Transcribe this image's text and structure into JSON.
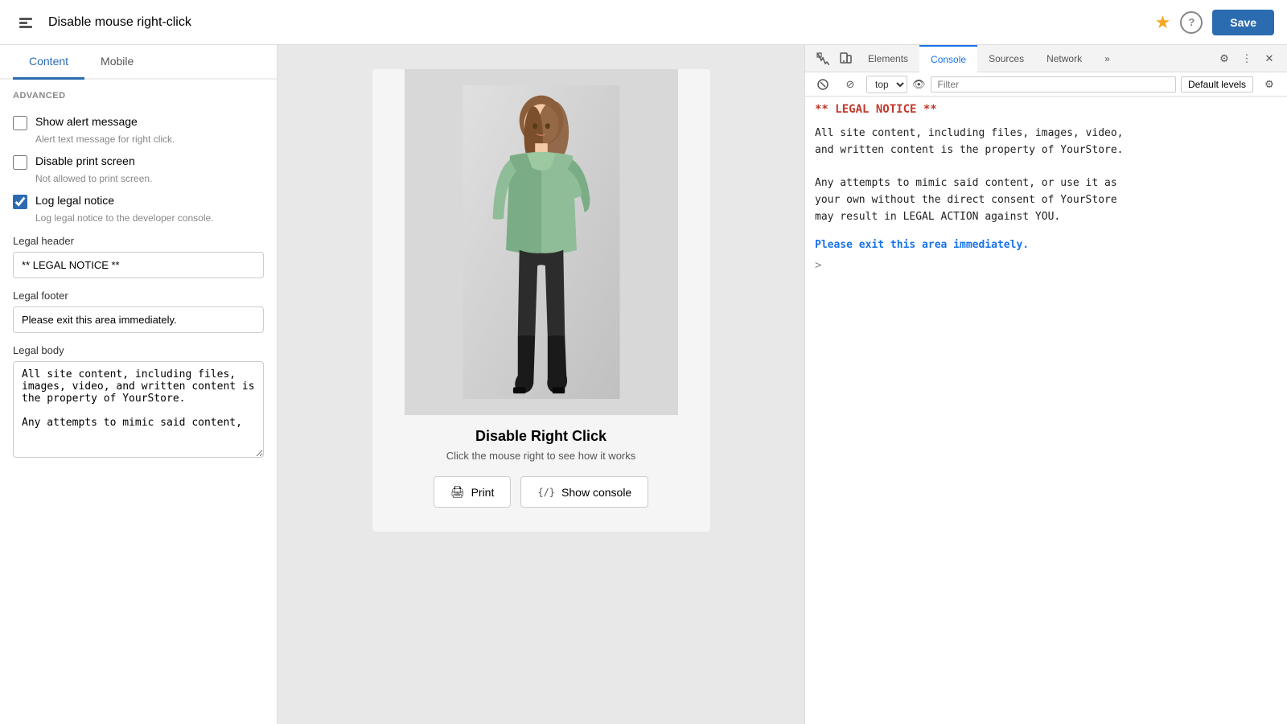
{
  "topbar": {
    "back_icon": "←",
    "title": "Disable mouse right-click",
    "star_icon": "★",
    "help_icon": "?",
    "save_label": "Save"
  },
  "tabs": {
    "content_label": "Content",
    "mobile_label": "Mobile"
  },
  "settings": {
    "section_label": "ADVANCED",
    "show_alert": {
      "label": "Show alert message",
      "help": "Alert text message for right click.",
      "checked": false
    },
    "disable_print": {
      "label": "Disable print screen",
      "help": "Not allowed to print screen.",
      "checked": false
    },
    "log_legal": {
      "label": "Log legal notice",
      "help": "Log legal notice to the developer console.",
      "checked": true
    },
    "legal_header": {
      "label": "Legal header",
      "value": "** LEGAL NOTICE **"
    },
    "legal_footer": {
      "label": "Legal footer",
      "value": "Please exit this area immediately."
    },
    "legal_body": {
      "label": "Legal body",
      "value": "All site content, including files, images, video, and written content is the property of YourStore.\n\nAny attempts to mimic said content,"
    }
  },
  "preview": {
    "title": "Disable Right Click",
    "subtitle": "Click the mouse right to see how it works",
    "print_btn": "Print",
    "console_btn": "Show console",
    "print_icon": "🖨",
    "console_icon": "{/}"
  },
  "devtools": {
    "tabs": [
      {
        "label": "Elements"
      },
      {
        "label": "Console",
        "active": true
      },
      {
        "label": "Sources"
      },
      {
        "label": "Network"
      },
      {
        "label": "»"
      }
    ],
    "toolbar": {
      "context": "top",
      "filter_placeholder": "Filter",
      "levels": "Default levels"
    },
    "console": {
      "legal_header": "** LEGAL NOTICE **",
      "body_line1": "All site content, including files, images, video,",
      "body_line2": "and written content is the property of YourStore.",
      "body_line3": "",
      "body_line4": "Any attempts to mimic said content, or use it as",
      "body_line5": "your own without the direct consent of YourStore",
      "body_line6": "may result in LEGAL ACTION against YOU.",
      "footer": "Please exit this area immediately.",
      "prompt": ">"
    }
  }
}
